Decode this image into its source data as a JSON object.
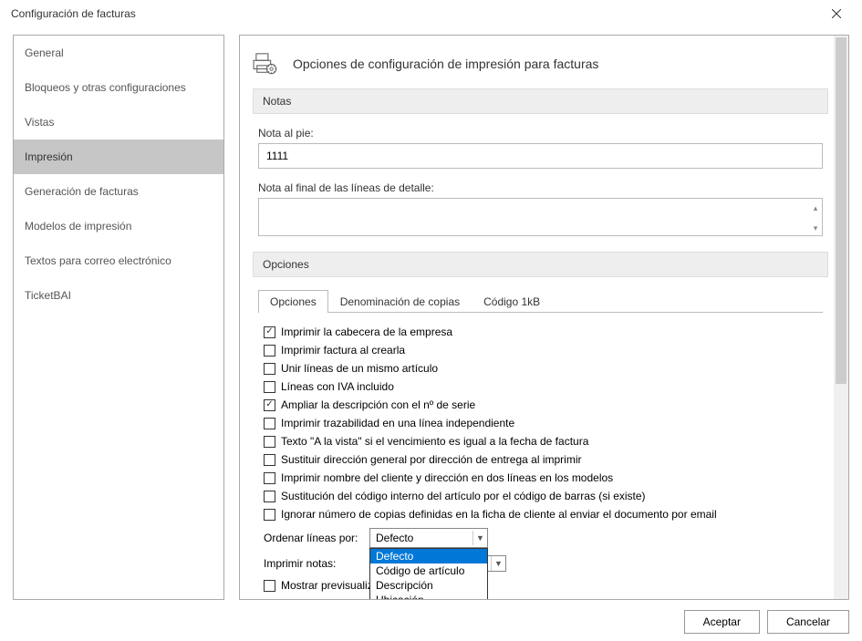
{
  "window": {
    "title": "Configuración de facturas"
  },
  "sidebar": {
    "items": [
      {
        "label": "General"
      },
      {
        "label": "Bloqueos y otras configuraciones"
      },
      {
        "label": "Vistas"
      },
      {
        "label": "Impresión"
      },
      {
        "label": "Generación de facturas"
      },
      {
        "label": "Modelos de impresión"
      },
      {
        "label": "Textos para correo electrónico"
      },
      {
        "label": "TicketBAI"
      }
    ],
    "selected_index": 3
  },
  "page": {
    "title": "Opciones de configuración de impresión para facturas",
    "sections": {
      "notas": {
        "header": "Notas",
        "footer_label": "Nota al pie:",
        "footer_value": "1111",
        "detail_label": "Nota al final de las líneas de detalle:",
        "detail_value": ""
      },
      "opciones": {
        "header": "Opciones",
        "tabs": [
          {
            "label": "Opciones"
          },
          {
            "label": "Denominación de copias"
          },
          {
            "label": "Código 1kB"
          }
        ],
        "checks": [
          {
            "checked": true,
            "label": "Imprimir la cabecera de la empresa"
          },
          {
            "checked": false,
            "label": "Imprimir factura al crearla"
          },
          {
            "checked": false,
            "label": "Unir líneas de un mismo artículo"
          },
          {
            "checked": false,
            "label": "Líneas con IVA incluido"
          },
          {
            "checked": true,
            "label": "Ampliar la descripción con el nº de serie"
          },
          {
            "checked": false,
            "label": "Imprimir trazabilidad en una línea independiente"
          },
          {
            "checked": false,
            "label": "Texto \"A la vista\" si el vencimiento es igual a la fecha de factura"
          },
          {
            "checked": false,
            "label": "Sustituir dirección general por dirección de entrega al imprimir"
          },
          {
            "checked": false,
            "label": "Imprimir nombre del cliente y dirección en dos líneas en los modelos"
          },
          {
            "checked": false,
            "label": "Sustitución del código interno del artículo por el código de barras (si existe)"
          },
          {
            "checked": false,
            "label": "Ignorar número de copias definidas en la ficha de cliente al enviar el documento por email"
          }
        ],
        "order_label": "Ordenar líneas por:",
        "order_value": "Defecto",
        "order_options": [
          "Defecto",
          "Código de artículo",
          "Descripción",
          "Ubicación"
        ],
        "notes_label": "Imprimir notas:",
        "notes_value": "",
        "preview_label": "Mostrar previsualiz",
        "preview_checked": false
      }
    }
  },
  "footer": {
    "accept": "Aceptar",
    "cancel": "Cancelar"
  }
}
